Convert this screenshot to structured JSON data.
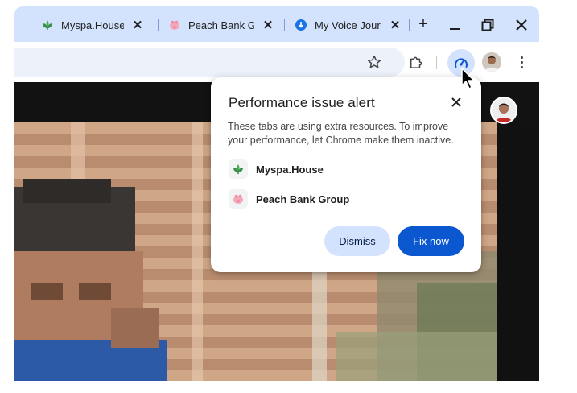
{
  "tabs": [
    {
      "title": "Myspa.House",
      "favicon": "leaf-icon"
    },
    {
      "title": "Peach Bank Gr",
      "favicon": "piggy-bank-icon"
    },
    {
      "title": "My Voice Jourr",
      "favicon": "download-icon"
    }
  ],
  "tabstrip": {
    "new_tab_label": "+",
    "close_glyph": "✕"
  },
  "toolbar": {
    "icons": [
      "star-icon",
      "extensions-icon",
      "performance-icon",
      "profile-avatar",
      "more-menu-icon"
    ]
  },
  "popup": {
    "title": "Performance issue alert",
    "body": "These tabs are using extra resources. To improve your performance, let Chrome make them inactive.",
    "items": [
      {
        "label": "Myspa.House",
        "icon": "leaf-icon"
      },
      {
        "label": "Peach Bank Group",
        "icon": "piggy-bank-icon"
      }
    ],
    "dismiss_label": "Dismiss",
    "fix_label": "Fix now"
  },
  "colors": {
    "tabstrip_bg": "#d3e3fd",
    "accent_blue": "#0b57d0",
    "tonal_blue": "#d3e3fd",
    "leaf_green": "#3a8f4a",
    "peach_pink": "#f4a7b9"
  }
}
